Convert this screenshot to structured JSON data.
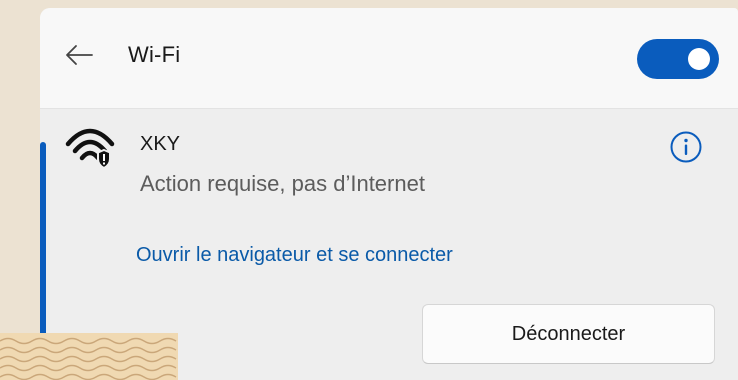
{
  "header": {
    "back_icon": "arrow-left-icon",
    "title": "Wi-Fi",
    "toggle_state": "on"
  },
  "network": {
    "icon": "wifi-warning-icon",
    "name": "XKY",
    "status": "Action requise, pas d’Internet",
    "info_icon": "info-icon",
    "link_label": "Ouvrir le navigateur et se connecter",
    "disconnect_label": "Déconnecter"
  },
  "colors": {
    "accent": "#0a5cbd",
    "link": "#0a5aa8",
    "panel": "#eeeeee",
    "header": "#f8f8f8",
    "background": "#ece2d2"
  }
}
